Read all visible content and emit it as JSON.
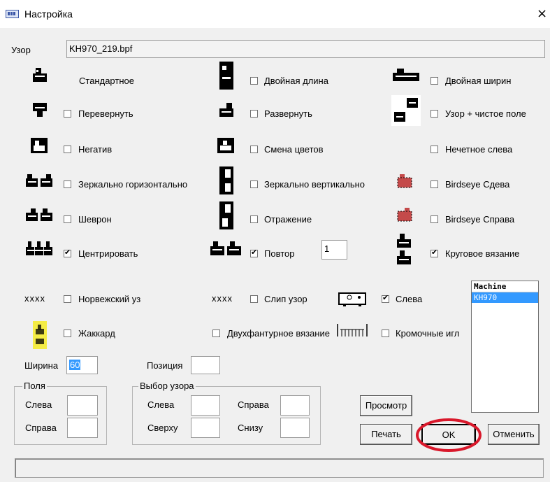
{
  "window": {
    "title": "Настройка",
    "close_glyph": "×"
  },
  "pattern": {
    "label": "Узор",
    "value": "KH970_219.bpf"
  },
  "options": {
    "standard": "Стандартное",
    "double_length": "Двойная длина",
    "double_width": "Двойная ширин",
    "flip": "Перевернуть",
    "rotate": "Развернуть",
    "pattern_clear": "Узор + чистое поле",
    "negative": "Негатив",
    "color_change": "Смена цветов",
    "odd_left": "Нечетное слева",
    "mirror_h": "Зеркально горизонтально",
    "mirror_v": "Зеркально вертикально",
    "birdseye_left": "Birdseye Сдева",
    "chevron": "Шеврон",
    "reflection": "Отражение",
    "birdseye_right": "Birdseye Справа",
    "center": "Центрировать",
    "repeat": "Повтор",
    "repeat_value": "1",
    "circular": "Круговое вязание",
    "norwegian": "Норвежский уз",
    "slip": "Слип узор",
    "left": "Слева",
    "jacquard": "Жаккард",
    "double_bed": "Двухфантурное вязание",
    "edge_needles": "Кромочные игл"
  },
  "xxxx_glyph": "xxxx",
  "width": {
    "label": "Ширина",
    "value": "60"
  },
  "position": {
    "label": "Позиция",
    "value": ""
  },
  "margins": {
    "title": "Поля",
    "left_label": "Слева",
    "right_label": "Справа"
  },
  "selection": {
    "title": "Выбор узора",
    "left_label": "Слева",
    "top_label": "Сверху",
    "right_label": "Справа",
    "bottom_label": "Снизу"
  },
  "machine_list": {
    "header": "Machine",
    "items": [
      "KH970"
    ]
  },
  "buttons": {
    "preview": "Просмотр",
    "print": "Печать",
    "ok": "OK",
    "cancel": "Отменить"
  },
  "colors": {
    "highlight": "#3399ff",
    "annotation": "#d9182b",
    "jacquard": "#f4ec45",
    "birdseye": "#c44a4a"
  }
}
